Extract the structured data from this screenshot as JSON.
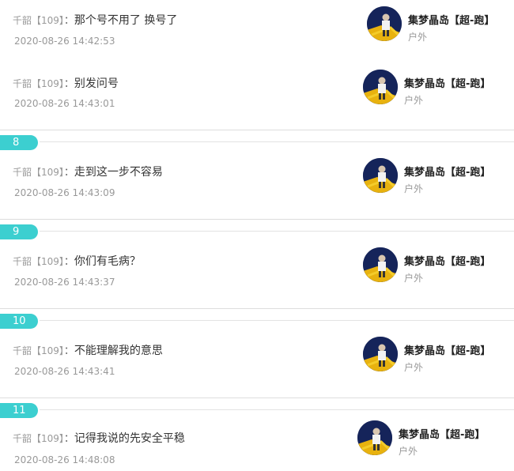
{
  "messages": [
    {
      "number": "",
      "sender": "千韶【109】",
      "colon": "：",
      "text": "那个号不用了 换号了",
      "timestamp": "2020-08-26 14:42:53",
      "user": {
        "name": "集梦晶岛【超-跑】",
        "category": "户外"
      }
    },
    {
      "number": "",
      "sender": "千韶【109】",
      "colon": "：",
      "text": "别发问号",
      "timestamp": "2020-08-26 14:43:01",
      "user": {
        "name": "集梦晶岛【超-跑】",
        "category": "户外"
      }
    },
    {
      "number": "8",
      "sender": "千韶【109】",
      "colon": "：",
      "text": "走到这一步不容易",
      "timestamp": "2020-08-26 14:43:09",
      "user": {
        "name": "集梦晶岛【超-跑】",
        "category": "户外"
      }
    },
    {
      "number": "9",
      "sender": "千韶【109】",
      "colon": "：",
      "text": "你们有毛病？",
      "timestamp": "2020-08-26 14:43:37",
      "user": {
        "name": "集梦晶岛【超-跑】",
        "category": "户外"
      }
    },
    {
      "number": "10",
      "sender": "千韶【109】",
      "colon": "：",
      "text": "不能理解我的意思",
      "timestamp": "2020-08-26 14:43:41",
      "user": {
        "name": "集梦晶岛【超-跑】",
        "category": "户外"
      }
    },
    {
      "number": "11",
      "sender": "千韶【109】",
      "colon": "：",
      "text": "记得我说的先安全平稳",
      "timestamp": "2020-08-26 14:48:08",
      "user": {
        "name": "集梦晶岛【超-跑】",
        "category": "户外"
      }
    }
  ],
  "colors": {
    "badge": "#3ccfd0",
    "muted": "#999999",
    "text": "#333333",
    "divider": "#dddddd"
  }
}
